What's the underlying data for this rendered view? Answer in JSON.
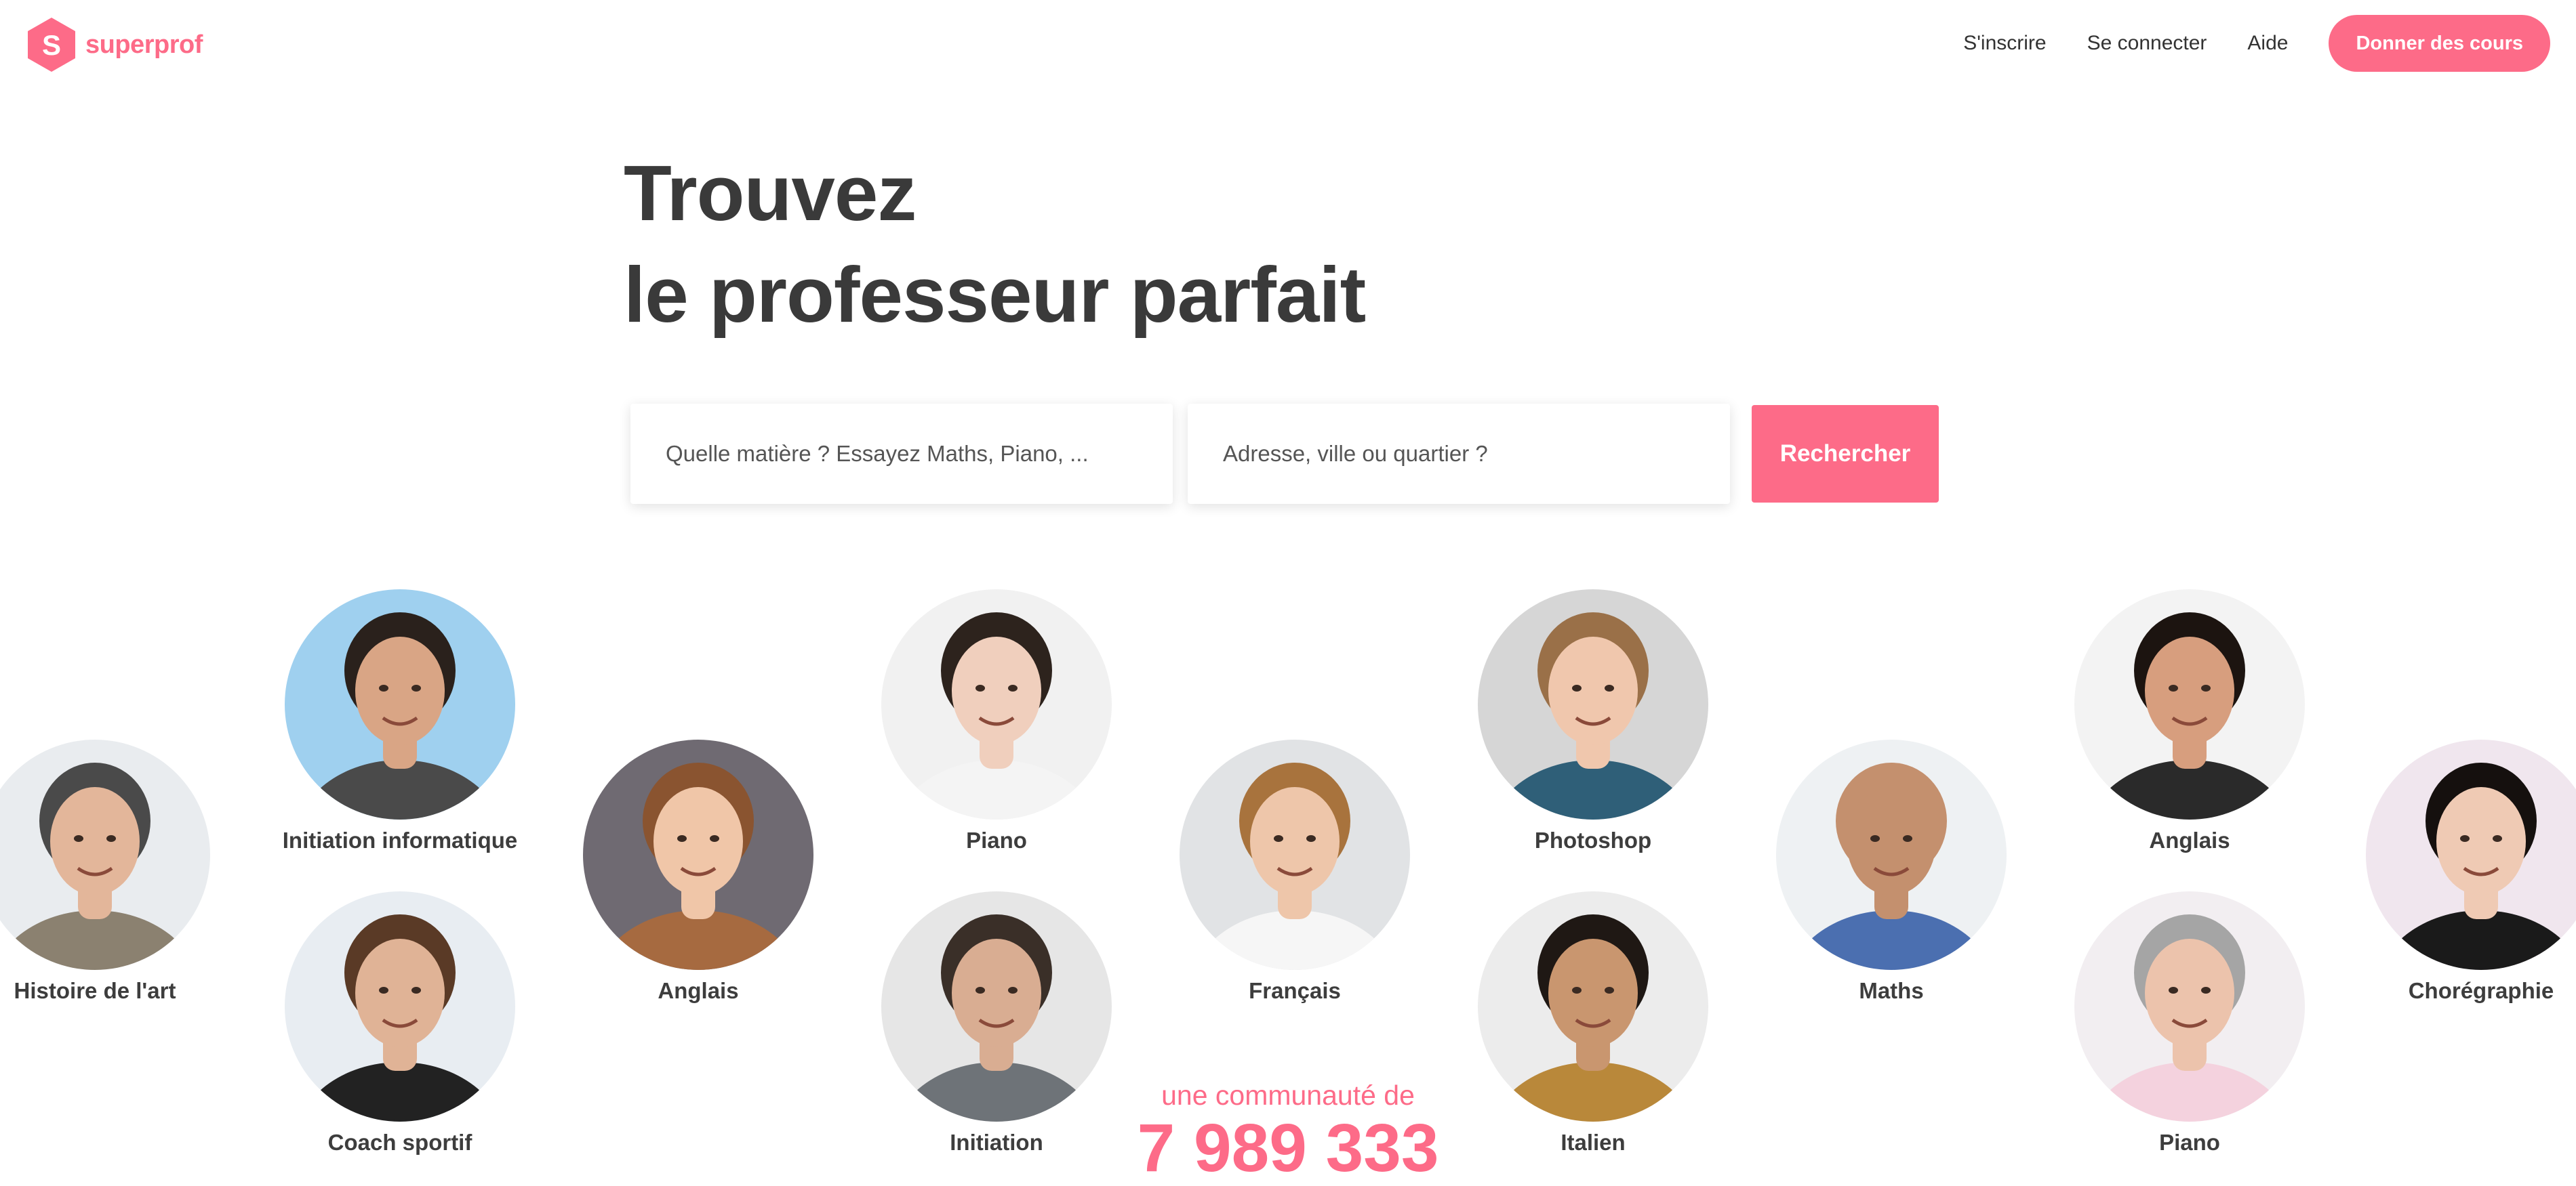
{
  "brand": {
    "name": "superprof",
    "logo_letter": "S",
    "accent": "#fd6b88"
  },
  "nav": {
    "signup": "S'inscrire",
    "login": "Se connecter",
    "help": "Aide",
    "teach": "Donner des cours"
  },
  "hero": {
    "title_line1": "Trouvez",
    "title_line2": "le professeur parfait"
  },
  "search": {
    "subject_placeholder": "Quelle matière ? Essayez Maths, Piano, ...",
    "address_placeholder": "Adresse, ville ou quartier ?",
    "button": "Rechercher"
  },
  "tutors": [
    {
      "subject": "Histoire de l'art",
      "bg": "#e9ecef",
      "skin": "#e3b69a",
      "hair": "#4a4a4a",
      "shirt": "#8b8170"
    },
    {
      "subject": "Initiation informatique",
      "bg": "#9fd0ef",
      "skin": "#d9a585",
      "hair": "#2a211c",
      "shirt": "#4a4a4a"
    },
    {
      "subject": "Coach sportif",
      "bg": "#e8edf2",
      "skin": "#e0b396",
      "hair": "#5a3a26",
      "shirt": "#222222"
    },
    {
      "subject": "Anglais",
      "bg": "#6f6a72",
      "skin": "#f0c6a8",
      "hair": "#8a5430",
      "shirt": "#a66a40"
    },
    {
      "subject": "Piano",
      "bg": "#f1f1f1",
      "skin": "#f0cfbd",
      "hair": "#2d231d",
      "shirt": "#f4f4f4"
    },
    {
      "subject": "Initiation",
      "bg": "#e6e6e6",
      "skin": "#d9ad92",
      "hair": "#3a2f28",
      "shirt": "#6e7378"
    },
    {
      "subject": "Français",
      "bg": "#e1e3e5",
      "skin": "#eec6aa",
      "hair": "#a8733d",
      "shirt": "#f6f6f6"
    },
    {
      "subject": "Photoshop",
      "bg": "#d6d6d6",
      "skin": "#f0c7ad",
      "hair": "#9a7048",
      "shirt": "#2f5f78"
    },
    {
      "subject": "Italien",
      "bg": "#ececec",
      "skin": "#c9966f",
      "hair": "#1f1814",
      "shirt": "#b9883a"
    },
    {
      "subject": "Maths",
      "bg": "#eef1f3",
      "skin": "#c4906e",
      "hair": "#c4906e",
      "shirt": "#4b6fb0"
    },
    {
      "subject": "Anglais",
      "bg": "#f3f3f3",
      "skin": "#d79e7e",
      "hair": "#1c1410",
      "shirt": "#2a2a2a"
    },
    {
      "subject": "Piano",
      "bg": "#f2eef1",
      "skin": "#ecc3ac",
      "hair": "#a5a5a5",
      "shirt": "#f4d2de"
    },
    {
      "subject": "Chorégraphie",
      "bg": "#f0e6ee",
      "skin": "#efcab4",
      "hair": "#15100e",
      "shirt": "#1a1a1a"
    }
  ],
  "community": {
    "label": "une communauté de",
    "count": "7 989 333"
  }
}
